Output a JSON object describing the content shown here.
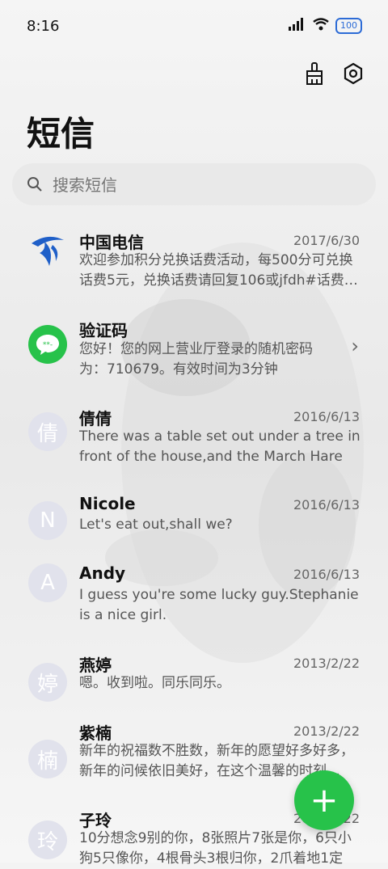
{
  "status_bar": {
    "time": "8:16",
    "battery": "100"
  },
  "header": {
    "title": "短信"
  },
  "search": {
    "placeholder": "搜索短信"
  },
  "messages": [
    {
      "name": "中国电信",
      "date": "2017/6/30",
      "preview": "欢迎参加积分兑换话费活动，每500分可兑换话费5元，兑换话费请回复106或jfdh#话费…"
    },
    {
      "name": "验证码",
      "date": "",
      "preview": "您好！您的网上营业厅登录的随机密码为：710679。有效时间为3分钟"
    },
    {
      "name": "倩倩",
      "avatar": "倩",
      "date": "2016/6/13",
      "preview": "There was a table set out under a tree in front of the house,and the March Hare an…"
    },
    {
      "name": "Nicole",
      "avatar": "N",
      "date": "2016/6/13",
      "preview": "Let's eat out,shall we?"
    },
    {
      "name": "Andy",
      "avatar": "A",
      "date": "2016/6/13",
      "preview": "I guess you're some lucky guy.Stephanie is a nice girl."
    },
    {
      "name": "燕婷",
      "avatar": "婷",
      "date": "2013/2/22",
      "preview": "嗯。收到啦。同乐同乐。"
    },
    {
      "name": "紫楠",
      "avatar": "楠",
      "date": "2013/2/22",
      "preview": "新年的祝福数不胜数，新年的愿望好多好多，新年的问候依旧美好，在这个温馨的时刻…"
    },
    {
      "name": "子玲",
      "avatar": "玲",
      "date": "2013/2/22",
      "preview": "10分想念9别的你，8张照片7张是你，6只小狗5只像你，4根骨头3根归你，2爪着地1定"
    }
  ],
  "colors": {
    "accent": "#27c24a",
    "telecom_blue": "#1f5fc8",
    "avatar_bg": "#e1e2ec"
  }
}
